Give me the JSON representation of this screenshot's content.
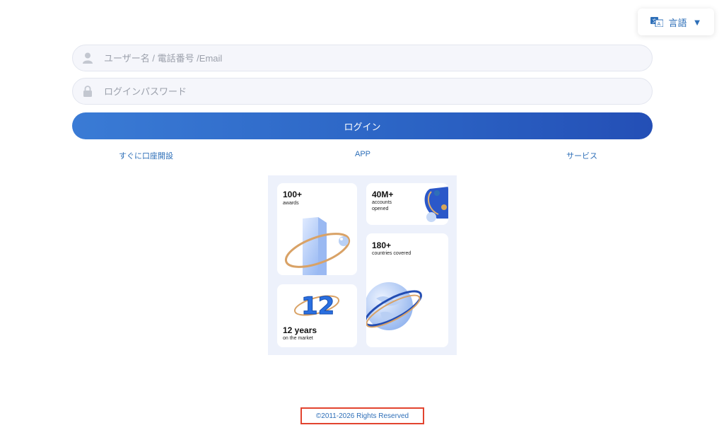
{
  "language": {
    "label": "言語",
    "icon": "translate-icon",
    "caret": "▼"
  },
  "login_form": {
    "username_placeholder": "ユーザー名 / 電話番号 /Email",
    "password_placeholder": "ログインパスワード",
    "username_icon": "user-icon",
    "password_icon": "lock-icon",
    "submit_label": "ログイン"
  },
  "links": {
    "open_account": "すぐに口座開設",
    "app": "APP",
    "services": "サービス"
  },
  "promo": {
    "awards": {
      "value": "100+",
      "caption": "awards"
    },
    "accounts": {
      "value": "40M+",
      "caption_line1": "accounts",
      "caption_line2": "opened"
    },
    "countries": {
      "value": "180+",
      "caption": "countries covered"
    },
    "years": {
      "badge": "12",
      "value": "12 years",
      "caption": "on the market"
    }
  },
  "footer": {
    "copyright": "©2011-2026 Rights Reserved"
  },
  "colors": {
    "accent": "#2e6fb8",
    "button_start": "#3a7bd5",
    "button_end": "#244fb6",
    "highlight_border": "#e2442f"
  }
}
